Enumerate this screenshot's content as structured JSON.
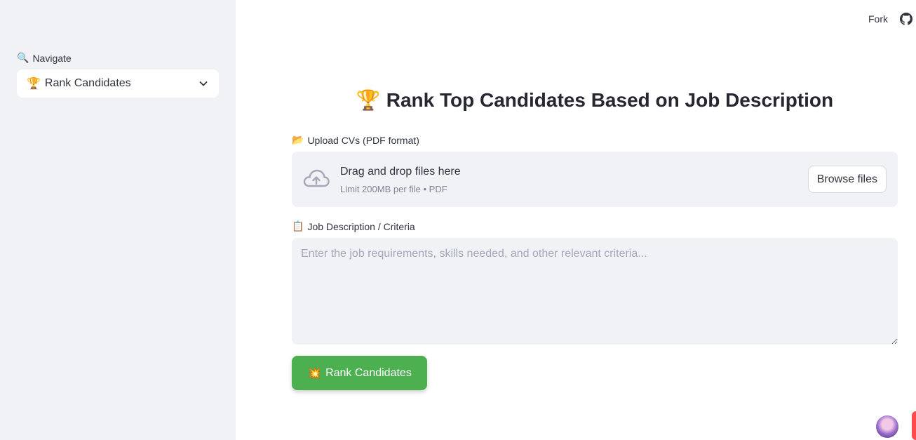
{
  "sidebar": {
    "nav_icon": "🔍",
    "nav_label": "Navigate",
    "select": {
      "icon": "🏆",
      "value": "Rank Candidates"
    }
  },
  "header": {
    "fork_label": "Fork"
  },
  "main": {
    "title_icon": "🏆",
    "title": "Rank Top Candidates Based on Job Description",
    "upload": {
      "icon": "📂",
      "label": "Upload CVs (PDF format)",
      "drop_text": "Drag and drop files here",
      "limit_text": "Limit 200MB per file • PDF",
      "browse_label": "Browse files"
    },
    "job": {
      "icon": "📋",
      "label": "Job Description / Criteria",
      "placeholder": "Enter the job requirements, skills needed, and other relevant criteria..."
    },
    "rank_button": {
      "icon": "💥",
      "label": "Rank Candidates"
    }
  },
  "colors": {
    "sidebar_bg": "#f0f2f6",
    "primary_button": "#4caf50",
    "text": "#31333f",
    "accent_red": "#ff4b4b"
  }
}
